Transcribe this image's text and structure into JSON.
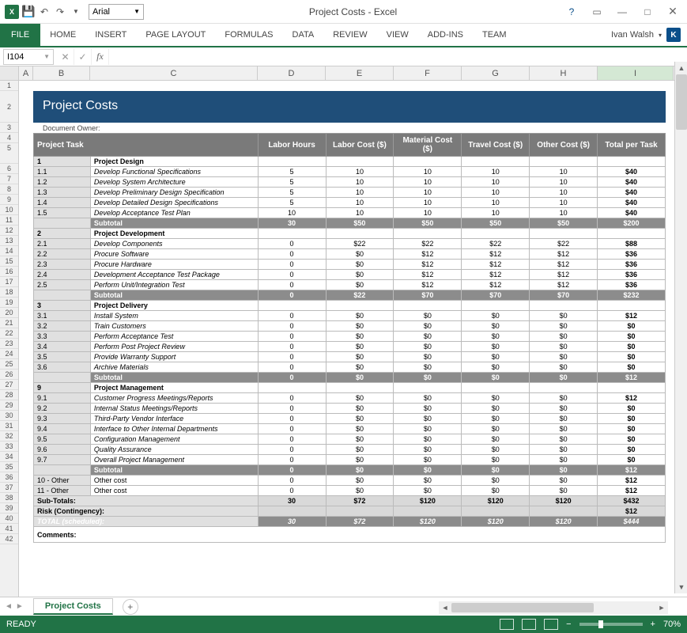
{
  "app": {
    "title": "Project Costs - Excel",
    "font": "Arial",
    "user": "Ivan Walsh",
    "userInitial": "K",
    "nameBox": "I104",
    "status": "READY",
    "zoom": "70%"
  },
  "ribbon": {
    "file": "FILE",
    "tabs": [
      "HOME",
      "INSERT",
      "PAGE LAYOUT",
      "FORMULAS",
      "DATA",
      "REVIEW",
      "VIEW",
      "ADD-INS",
      "TEAM"
    ]
  },
  "columns": [
    "A",
    "B",
    "C",
    "D",
    "E",
    "F",
    "G",
    "H",
    "I"
  ],
  "sheet": {
    "tabName": "Project Costs",
    "title": "Project Costs",
    "docOwner": "Document Owner:",
    "headers": [
      "Project Task",
      "Labor Hours",
      "Labor Cost ($)",
      "Material Cost ($)",
      "Travel Cost ($)",
      "Other Cost ($)",
      "Total per Task"
    ],
    "sections": [
      {
        "wbs": "1",
        "name": "Project Design",
        "rows": [
          {
            "wbs": "1.1",
            "task": "Develop Functional Specifications",
            "lh": "5",
            "lc": "10",
            "mc": "10",
            "tc": "10",
            "oc": "10",
            "tot": "$40"
          },
          {
            "wbs": "1.2",
            "task": "Develop System Architecture",
            "lh": "5",
            "lc": "10",
            "mc": "10",
            "tc": "10",
            "oc": "10",
            "tot": "$40"
          },
          {
            "wbs": "1.3",
            "task": "Develop Preliminary Design Specification",
            "lh": "5",
            "lc": "10",
            "mc": "10",
            "tc": "10",
            "oc": "10",
            "tot": "$40"
          },
          {
            "wbs": "1.4",
            "task": "Develop Detailed Design Specifications",
            "lh": "5",
            "lc": "10",
            "mc": "10",
            "tc": "10",
            "oc": "10",
            "tot": "$40"
          },
          {
            "wbs": "1.5",
            "task": "Develop Acceptance Test Plan",
            "lh": "10",
            "lc": "10",
            "mc": "10",
            "tc": "10",
            "oc": "10",
            "tot": "$40"
          }
        ],
        "subtotal": {
          "lh": "30",
          "lc": "$50",
          "mc": "$50",
          "tc": "$50",
          "oc": "$50",
          "tot": "$200"
        }
      },
      {
        "wbs": "2",
        "name": "Project Development",
        "rows": [
          {
            "wbs": "2.1",
            "task": "Develop Components",
            "lh": "0",
            "lc": "$22",
            "mc": "$22",
            "tc": "$22",
            "oc": "$22",
            "tot": "$88"
          },
          {
            "wbs": "2.2",
            "task": "Procure Software",
            "lh": "0",
            "lc": "$0",
            "mc": "$12",
            "tc": "$12",
            "oc": "$12",
            "tot": "$36"
          },
          {
            "wbs": "2.3",
            "task": "Procure Hardware",
            "lh": "0",
            "lc": "$0",
            "mc": "$12",
            "tc": "$12",
            "oc": "$12",
            "tot": "$36"
          },
          {
            "wbs": "2.4",
            "task": "Development Acceptance Test Package",
            "lh": "0",
            "lc": "$0",
            "mc": "$12",
            "tc": "$12",
            "oc": "$12",
            "tot": "$36"
          },
          {
            "wbs": "2.5",
            "task": "Perform Unit/Integration Test",
            "lh": "0",
            "lc": "$0",
            "mc": "$12",
            "tc": "$12",
            "oc": "$12",
            "tot": "$36"
          }
        ],
        "subtotal": {
          "lh": "0",
          "lc": "$22",
          "mc": "$70",
          "tc": "$70",
          "oc": "$70",
          "tot": "$232"
        }
      },
      {
        "wbs": "3",
        "name": "Project Delivery",
        "rows": [
          {
            "wbs": "3.1",
            "task": "Install System",
            "lh": "0",
            "lc": "$0",
            "mc": "$0",
            "tc": "$0",
            "oc": "$0",
            "tot": "$12"
          },
          {
            "wbs": "3.2",
            "task": "Train Customers",
            "lh": "0",
            "lc": "$0",
            "mc": "$0",
            "tc": "$0",
            "oc": "$0",
            "tot": "$0"
          },
          {
            "wbs": "3.3",
            "task": "Perform Acceptance Test",
            "lh": "0",
            "lc": "$0",
            "mc": "$0",
            "tc": "$0",
            "oc": "$0",
            "tot": "$0"
          },
          {
            "wbs": "3.4",
            "task": "Perform Post Project Review",
            "lh": "0",
            "lc": "$0",
            "mc": "$0",
            "tc": "$0",
            "oc": "$0",
            "tot": "$0"
          },
          {
            "wbs": "3.5",
            "task": "Provide Warranty Support",
            "lh": "0",
            "lc": "$0",
            "mc": "$0",
            "tc": "$0",
            "oc": "$0",
            "tot": "$0"
          },
          {
            "wbs": "3.6",
            "task": "Archive Materials",
            "lh": "0",
            "lc": "$0",
            "mc": "$0",
            "tc": "$0",
            "oc": "$0",
            "tot": "$0"
          }
        ],
        "subtotal": {
          "lh": "0",
          "lc": "$0",
          "mc": "$0",
          "tc": "$0",
          "oc": "$0",
          "tot": "$12"
        }
      },
      {
        "wbs": "9",
        "name": "Project Management",
        "rows": [
          {
            "wbs": "9.1",
            "task": "Customer Progress Meetings/Reports",
            "lh": "0",
            "lc": "$0",
            "mc": "$0",
            "tc": "$0",
            "oc": "$0",
            "tot": "$12"
          },
          {
            "wbs": "9.2",
            "task": "Internal Status Meetings/Reports",
            "lh": "0",
            "lc": "$0",
            "mc": "$0",
            "tc": "$0",
            "oc": "$0",
            "tot": "$0"
          },
          {
            "wbs": "9.3",
            "task": "Third-Party Vendor Interface",
            "lh": "0",
            "lc": "$0",
            "mc": "$0",
            "tc": "$0",
            "oc": "$0",
            "tot": "$0"
          },
          {
            "wbs": "9.4",
            "task": "Interface to Other Internal Departments",
            "lh": "0",
            "lc": "$0",
            "mc": "$0",
            "tc": "$0",
            "oc": "$0",
            "tot": "$0"
          },
          {
            "wbs": "9.5",
            "task": "Configuration Management",
            "lh": "0",
            "lc": "$0",
            "mc": "$0",
            "tc": "$0",
            "oc": "$0",
            "tot": "$0"
          },
          {
            "wbs": "9.6",
            "task": "Quality Assurance",
            "lh": "0",
            "lc": "$0",
            "mc": "$0",
            "tc": "$0",
            "oc": "$0",
            "tot": "$0"
          },
          {
            "wbs": "9.7",
            "task": "Overall Project Management",
            "lh": "0",
            "lc": "$0",
            "mc": "$0",
            "tc": "$0",
            "oc": "$0",
            "tot": "$0"
          }
        ],
        "subtotal": {
          "lh": "0",
          "lc": "$0",
          "mc": "$0",
          "tc": "$0",
          "oc": "$0",
          "tot": "$12"
        }
      }
    ],
    "otherRows": [
      {
        "wbs": "10 - Other",
        "task": "Other cost",
        "lh": "0",
        "lc": "$0",
        "mc": "$0",
        "tc": "$0",
        "oc": "$0",
        "tot": "$12"
      },
      {
        "wbs": "11 - Other",
        "task": "Other cost",
        "lh": "0",
        "lc": "$0",
        "mc": "$0",
        "tc": "$0",
        "oc": "$0",
        "tot": "$12"
      }
    ],
    "subtotals": {
      "label": "Sub-Totals:",
      "lh": "30",
      "lc": "$72",
      "mc": "$120",
      "tc": "$120",
      "oc": "$120",
      "tot": "$432"
    },
    "risk": {
      "label": "Risk (Contingency):",
      "lh": "",
      "lc": "",
      "mc": "",
      "tc": "",
      "oc": "",
      "tot": "$12"
    },
    "total": {
      "label": "TOTAL (scheduled):",
      "lh": "30",
      "lc": "$72",
      "mc": "$120",
      "tc": "$120",
      "oc": "$120",
      "tot": "$444"
    },
    "subtotalLabel": "Subtotal",
    "comments": "Comments:"
  }
}
